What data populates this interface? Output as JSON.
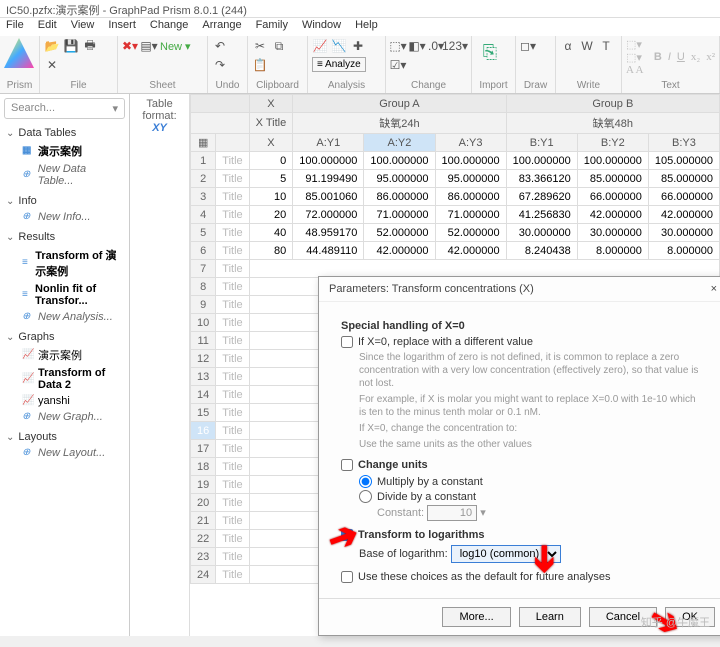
{
  "window": {
    "title": "IC50.pzfx:演示案例 - GraphPad Prism 8.0.1 (244)"
  },
  "menu": [
    "File",
    "Edit",
    "View",
    "Insert",
    "Change",
    "Arrange",
    "Family",
    "Window",
    "Help"
  ],
  "ribbon": {
    "groups": [
      "Prism",
      "File",
      "Sheet",
      "Undo",
      "Clipboard",
      "Analysis",
      "Change",
      "Import",
      "Draw",
      "Write",
      "Text"
    ],
    "new_label": "New ▾",
    "analyze_label": "≡ Analyze"
  },
  "nav": {
    "search_placeholder": "Search...",
    "sections": {
      "data_tables": {
        "label": "Data Tables",
        "items": [
          "演示案例"
        ],
        "new": "New Data Table..."
      },
      "info": {
        "label": "Info",
        "new": "New Info..."
      },
      "results": {
        "label": "Results",
        "items": [
          "Transform of 演示案例",
          "Nonlin fit of Transfor..."
        ],
        "new": "New Analysis..."
      },
      "graphs": {
        "label": "Graphs",
        "items": [
          "演示案例",
          "Transform of Data 2",
          "yanshi"
        ],
        "new": "New Graph..."
      },
      "layouts": {
        "label": "Layouts",
        "new": "New Layout..."
      }
    }
  },
  "table": {
    "format_label": "Table format:",
    "format_value": "XY",
    "x_header": "X",
    "xtitle": "X Title",
    "groups": [
      {
        "name": "Group A",
        "subtitle": "缺氧24h",
        "cols": [
          "A:Y1",
          "A:Y2",
          "A:Y3"
        ]
      },
      {
        "name": "Group B",
        "subtitle": "缺氧48h",
        "cols": [
          "B:Y1",
          "B:Y2",
          "B:Y3"
        ]
      }
    ],
    "row_title": "Title",
    "rows": [
      {
        "n": 1,
        "x": "0",
        "v": [
          "100.000000",
          "100.000000",
          "100.000000",
          "100.000000",
          "100.000000",
          "105.000000"
        ]
      },
      {
        "n": 2,
        "x": "5",
        "v": [
          "91.199490",
          "95.000000",
          "95.000000",
          "83.366120",
          "85.000000",
          "85.000000"
        ]
      },
      {
        "n": 3,
        "x": "10",
        "v": [
          "85.001060",
          "86.000000",
          "86.000000",
          "67.289620",
          "66.000000",
          "66.000000"
        ]
      },
      {
        "n": 4,
        "x": "20",
        "v": [
          "72.000000",
          "71.000000",
          "71.000000",
          "41.256830",
          "42.000000",
          "42.000000"
        ]
      },
      {
        "n": 5,
        "x": "40",
        "v": [
          "48.959170",
          "52.000000",
          "52.000000",
          "30.000000",
          "30.000000",
          "30.000000"
        ]
      },
      {
        "n": 6,
        "x": "80",
        "v": [
          "44.489110",
          "42.000000",
          "42.000000",
          "8.240438",
          "8.000000",
          "8.000000"
        ]
      }
    ],
    "empty_rows": [
      7,
      8,
      9,
      10,
      11,
      12,
      13,
      14,
      15,
      16,
      17,
      18,
      19,
      20,
      21,
      22,
      23,
      24
    ],
    "highlight_row": 16
  },
  "dialog": {
    "title": "Parameters: Transform concentrations (X)",
    "close": "×",
    "sec1": "Special handling of X=0",
    "cb_replace": "If X=0, replace with a different value",
    "hint1": "Since the logarithm of zero is not defined, it is common to replace a zero concentration with a very low concentration (effectively zero), so that value is not lost.",
    "hint2": "For example, if X is molar you might want to replace X=0.0 with 1e-10 which is ten to the minus tenth molar or  0.1 nM.",
    "hint3": "If X=0, change the concentration to:",
    "hint4": "Use the same units as the other values",
    "sec2": "Change units",
    "r_mult": "Multiply by a constant",
    "r_div": "Divide by a constant",
    "const_label": "Constant:",
    "const_value": "10",
    "sec3": "Transform to logarithms",
    "base_label": "Base of logarithm:",
    "base_value": "log10 (common)",
    "cb_default": "Use these choices as the default for future analyses",
    "btn_more": "More...",
    "btn_learn": "Learn",
    "btn_cancel": "Cancel",
    "btn_ok": "OK"
  },
  "watermark": "知乎 @牛魔王"
}
